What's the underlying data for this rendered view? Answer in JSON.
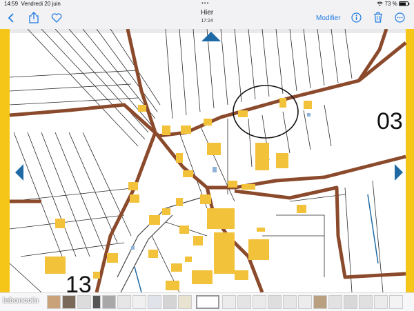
{
  "status": {
    "time": "14:59",
    "date": "Vendredi 20 juin",
    "battery": "73 %"
  },
  "nav": {
    "title": "Hier",
    "subtitle": "17:24",
    "edit_label": "Modifier"
  },
  "photo": {
    "number_right": "03",
    "number_bottom": "13"
  },
  "watermark": {
    "text": "leboncoin"
  },
  "colors": {
    "accent": "#1f7ae0",
    "road": "#8b4a2b",
    "building": "#f2c23a",
    "edge_bar": "#f5c518",
    "arrow": "#1f6aa5"
  }
}
